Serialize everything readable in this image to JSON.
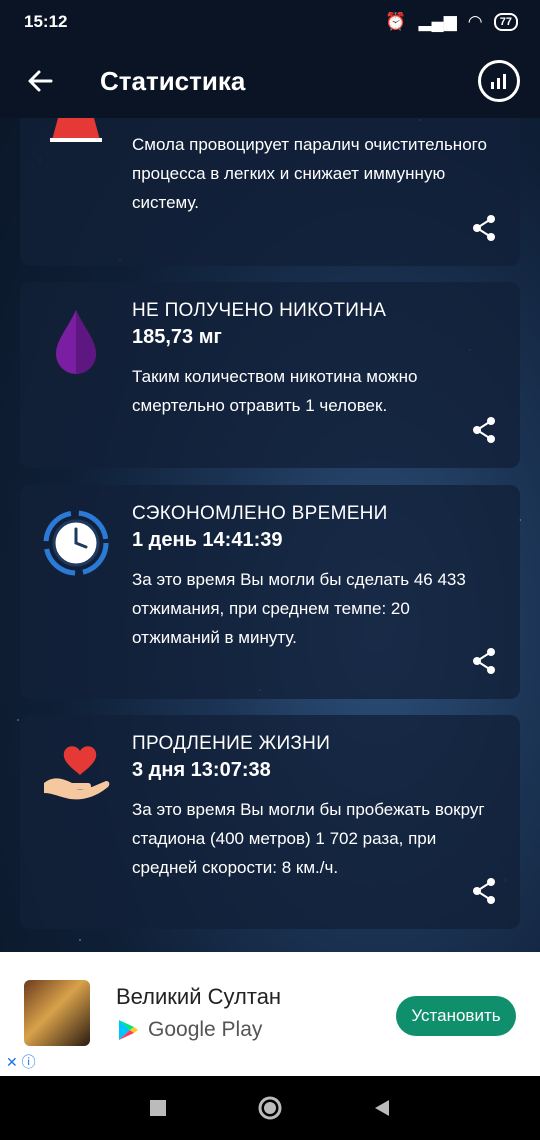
{
  "status": {
    "time": "15:12",
    "battery": "77"
  },
  "appbar": {
    "title": "Статистика"
  },
  "cards": [
    {
      "label": "",
      "value": "",
      "description": "Смола провоцирует паралич очистительного процесса в легких и снижает иммунную систему."
    },
    {
      "label": "НЕ ПОЛУЧЕНО НИКОТИНА",
      "value": "185,73 мг",
      "description": "Таким количеством никотина можно смертельно отравить 1 человек."
    },
    {
      "label": "СЭКОНОМЛЕНО ВРЕМЕНИ",
      "value": "1 день 14:41:39",
      "description": "За это время Вы могли бы сделать 46 433 отжимания, при среднем темпе: 20 отжиманий в минуту."
    },
    {
      "label": "ПРОДЛЕНИЕ ЖИЗНИ",
      "value": "3 дня 13:07:38",
      "description": "За это время Вы могли бы пробежать вокруг стадиона (400 метров) 1 702 раза, при средней скорости: 8 км./ч."
    }
  ],
  "ad": {
    "title": "Великий Султан",
    "store": "Google Play",
    "install_label": "Установить"
  },
  "colors": {
    "accent": "#0f8f6b",
    "tar": "#e53935",
    "nicotine": "#7b1fa2",
    "clock": "#2b7bd6",
    "heart": "#e53935"
  }
}
